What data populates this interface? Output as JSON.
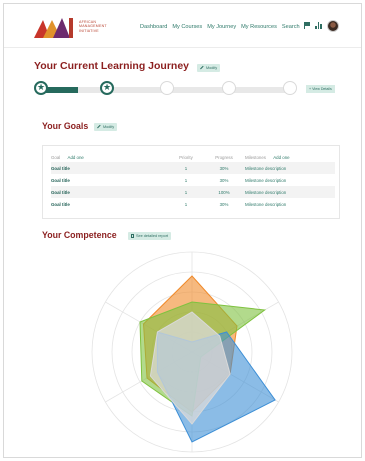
{
  "header": {
    "logo_lines": [
      "AFRICAN",
      "MANAGEMENT",
      "INITIATIVE"
    ],
    "nav": [
      "Dashboard",
      "My Courses",
      "My Journey",
      "My Resources",
      "Search"
    ],
    "colors": {
      "accent": "#266a5d",
      "title": "#8b1f1f",
      "link": "#2f7a6a"
    }
  },
  "journey": {
    "title": "Your Current Learning Journey",
    "modify_label": "Modify",
    "view_details_label": "+ View Details",
    "progress": {
      "completed_stages": 2,
      "total_stages": 6
    }
  },
  "goals": {
    "title": "Your Goals",
    "modify_label": "Modify",
    "columns": {
      "goal": "Goal",
      "add_one": "Add one",
      "priority": "Priority",
      "progress": "Progress",
      "milestones": "Milestones",
      "add_one_2": "Add one"
    },
    "rows": [
      {
        "title": "Goal title",
        "priority": "1",
        "progress": "30%",
        "milestone": "Milestone description"
      },
      {
        "title": "Goal title",
        "priority": "1",
        "progress": "30%",
        "milestone": "Milestone description"
      },
      {
        "title": "Goal title",
        "priority": "1",
        "progress": "100%",
        "milestone": "Milestone description"
      },
      {
        "title": "Goal title",
        "priority": "1",
        "progress": "30%",
        "milestone": "Milestone description"
      }
    ]
  },
  "competence": {
    "title": "Your Competence",
    "report_label": "See detailed report",
    "chart_data": {
      "type": "radar",
      "axes": 6,
      "scale_max": 5,
      "series": [
        {
          "color": "#f08a2a",
          "values": [
            3.8,
            2.6,
            2.2,
            3.0,
            2.6,
            2.8
          ]
        },
        {
          "color": "#7fc23f",
          "values": [
            2.5,
            4.2,
            0.5,
            3.2,
            2.9,
            3.0
          ]
        },
        {
          "color": "#3d8fd6",
          "values": [
            0.5,
            2.0,
            4.8,
            4.5,
            2.0,
            2.0
          ]
        },
        {
          "color": "#d9d9d9",
          "values": [
            2.0,
            1.6,
            2.2,
            3.6,
            2.4,
            2.0
          ]
        }
      ]
    }
  }
}
